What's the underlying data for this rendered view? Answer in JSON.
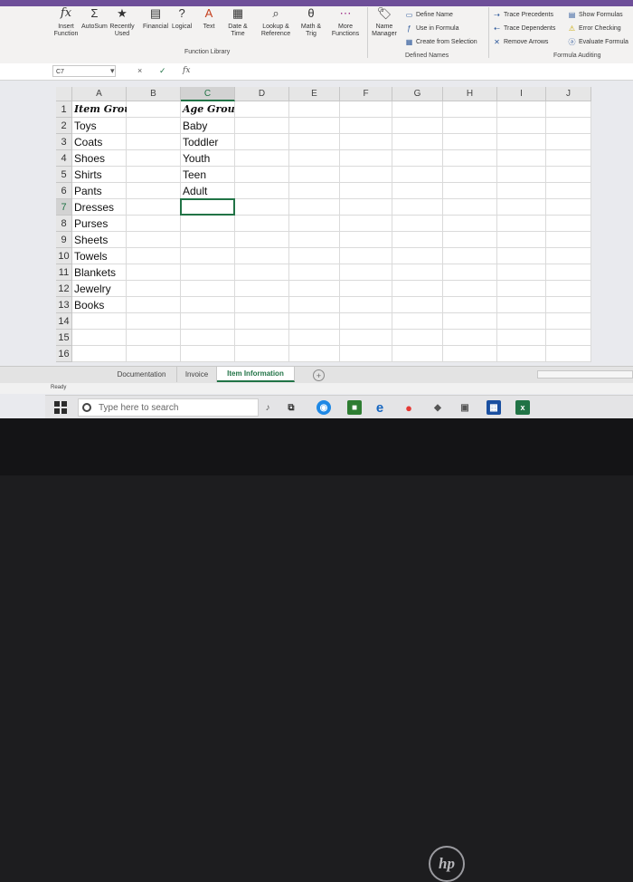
{
  "ribbon": {
    "function_library": {
      "insert_function": "Insert Function",
      "autosum": "AutoSum",
      "recently_used": "Recently Used",
      "financial": "Financial",
      "logical": "Logical",
      "text": "Text",
      "date_time": "Date & Time",
      "lookup_reference": "Lookup & Reference",
      "math_trig": "Math & Trig",
      "more_functions": "More Functions",
      "group_label": "Function Library"
    },
    "defined_names": {
      "name_manager": "Name Manager",
      "define_name": "Define Name",
      "use_in_formula": "Use in Formula",
      "create_from_selection": "Create from Selection",
      "group_label": "Defined Names"
    },
    "formula_auditing": {
      "trace_precedents": "Trace Precedents",
      "trace_dependents": "Trace Dependents",
      "remove_arrows": "Remove Arrows",
      "show_formulas": "Show Formulas",
      "error_checking": "Error Checking",
      "evaluate_formula": "Evaluate Formula",
      "group_label": "Formula Auditing"
    }
  },
  "formula_bar": {
    "name_box": "C7",
    "fx": "fx",
    "cancel": "×",
    "enter": "✓",
    "content": ""
  },
  "sheet": {
    "columns": [
      "A",
      "B",
      "C",
      "D",
      "E",
      "F",
      "G",
      "H",
      "I",
      "J"
    ],
    "rows": [
      "1",
      "2",
      "3",
      "4",
      "5",
      "6",
      "7",
      "8",
      "9",
      "10",
      "11",
      "12",
      "13",
      "14",
      "15",
      "16"
    ],
    "column_a": [
      "Item Group",
      "Toys",
      "Coats",
      "Shoes",
      "Shirts",
      "Pants",
      "Dresses",
      "Purses",
      "Sheets",
      "Towels",
      "Blankets",
      "Jewelry",
      "Books",
      "",
      "",
      ""
    ],
    "column_c": [
      "Age Group",
      "Baby",
      "Toddler",
      "Youth",
      "Teen",
      "Adult",
      "",
      "",
      "",
      "",
      "",
      "",
      "",
      "",
      "",
      ""
    ]
  },
  "tabs": [
    "Documentation",
    "Invoice",
    "Item Information"
  ],
  "tabs_add": "+",
  "status": "Ready",
  "taskbar": {
    "search_placeholder": "Type here to search"
  },
  "colors": {
    "excel_green": "#217346",
    "ribbon_bg": "#f3f2f1"
  }
}
